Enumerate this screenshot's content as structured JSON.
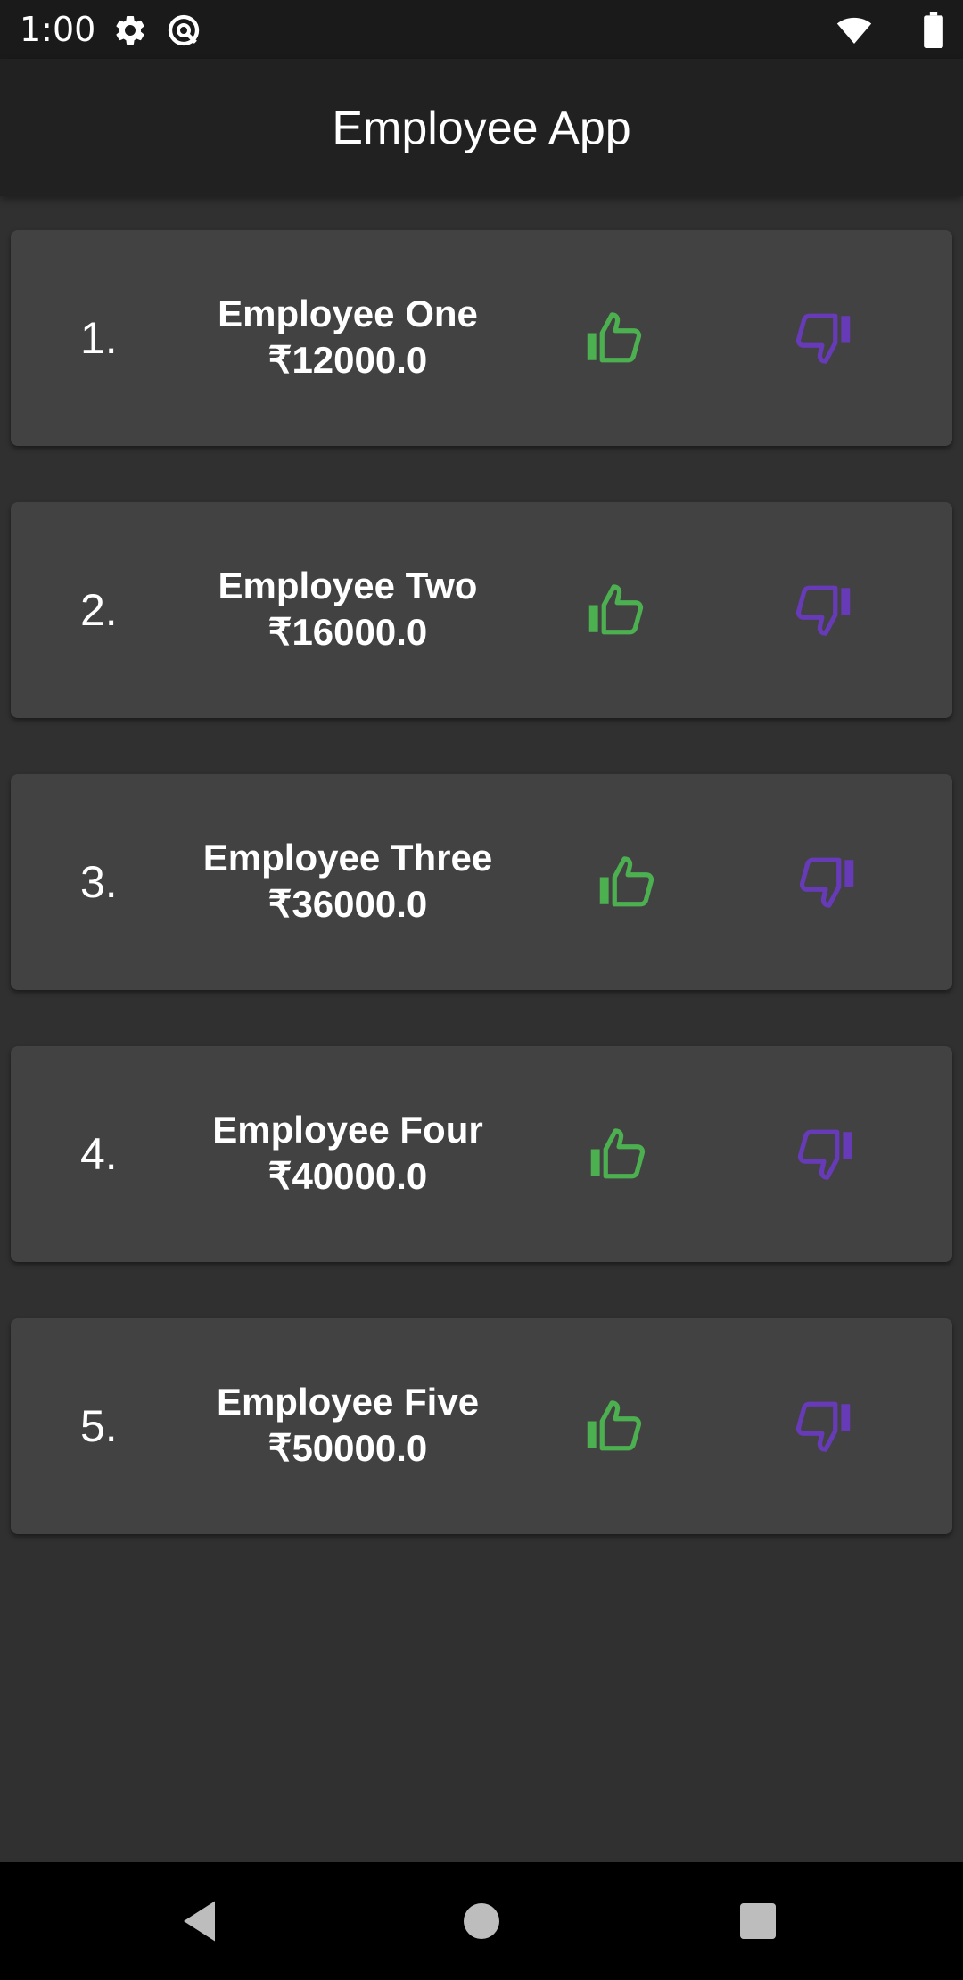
{
  "status_bar": {
    "time": "1:00",
    "icons": [
      "gear-icon",
      "sync-icon",
      "wifi-icon",
      "battery-icon"
    ]
  },
  "app_bar": {
    "title": "Employee App"
  },
  "employees": [
    {
      "index": "1.",
      "name": "Employee One",
      "salary": "₹12000.0"
    },
    {
      "index": "2.",
      "name": "Employee Two",
      "salary": "₹16000.0"
    },
    {
      "index": "3.",
      "name": "Employee Three",
      "salary": "₹36000.0"
    },
    {
      "index": "4.",
      "name": "Employee Four",
      "salary": "₹40000.0"
    },
    {
      "index": "5.",
      "name": "Employee Five",
      "salary": "₹50000.0"
    }
  ],
  "colors": {
    "like": "#4caf50",
    "dislike": "#673ab7",
    "card": "#424242",
    "background": "#303030",
    "app_bar": "#212121"
  },
  "nav_bar": {
    "icons": [
      "back-icon",
      "home-icon",
      "recents-icon"
    ]
  }
}
